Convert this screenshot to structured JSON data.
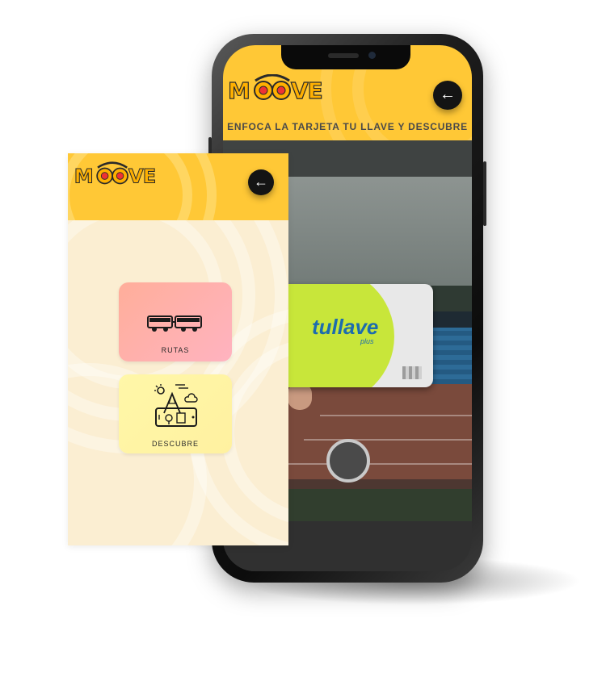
{
  "brand": {
    "logo_text": "MOOVE",
    "accent": "#ffc836",
    "dark": "#141414"
  },
  "phone_screen": {
    "caption": "ENFOCA LA TARJETA TU LLAVE Y DESCUBRE",
    "back_icon": "←",
    "card": {
      "logo_text": "tullave",
      "logo_plus": "plus"
    }
  },
  "panel": {
    "back_icon": "←",
    "tiles": [
      {
        "label": "RUTAS",
        "icon": "bus-icon",
        "color": "#ffb0a8"
      },
      {
        "label": "DESCUBRE",
        "icon": "city-tablet-icon",
        "color": "#fff4a4"
      }
    ]
  }
}
